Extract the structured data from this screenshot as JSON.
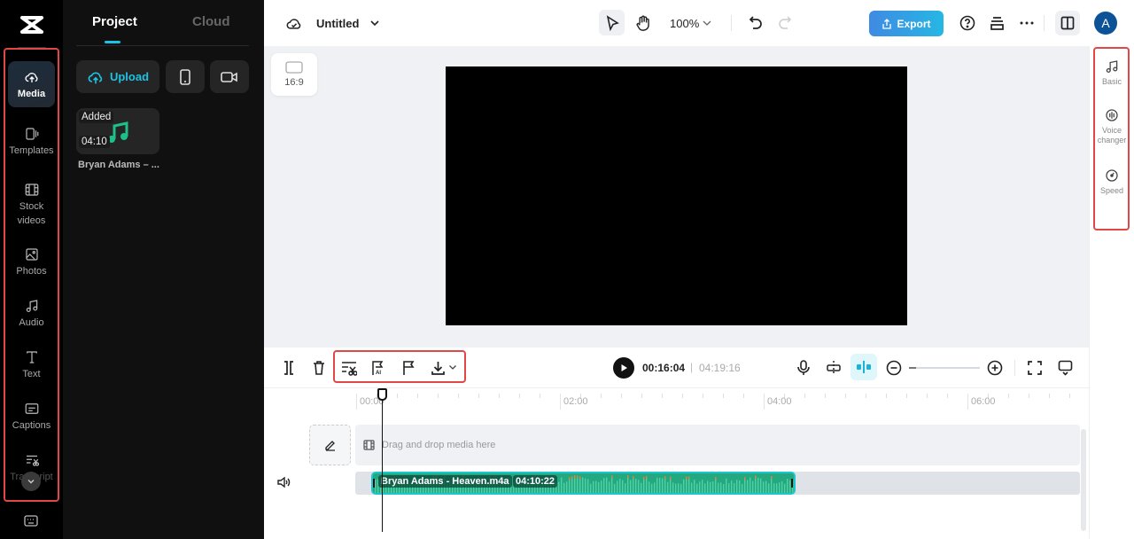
{
  "app": {
    "logo": "capcut-logo-icon"
  },
  "rail": {
    "items": [
      {
        "label": "Media",
        "icon": "cloud-upload-icon",
        "active": true
      },
      {
        "label": "Templates",
        "icon": "templates-icon"
      },
      {
        "label": "Stock videos",
        "icon": "film-icon"
      },
      {
        "label": "Photos",
        "icon": "photo-icon"
      },
      {
        "label": "Audio",
        "icon": "music-note-icon"
      },
      {
        "label": "Text",
        "icon": "text-icon"
      },
      {
        "label": "Captions",
        "icon": "captions-icon"
      },
      {
        "label": "Transcript",
        "icon": "transcript-icon"
      }
    ],
    "more": "chevron-down-icon",
    "keyboard": "keyboard-icon"
  },
  "panel": {
    "tabs": [
      {
        "label": "Project",
        "active": true
      },
      {
        "label": "Cloud"
      }
    ],
    "upload_label": "Upload",
    "media": [
      {
        "badge": "Added",
        "duration": "04:10",
        "title": "Bryan Adams – ..."
      }
    ]
  },
  "topbar": {
    "project_name": "Untitled",
    "zoom": "100%",
    "export_label": "Export",
    "avatar_initial": "A"
  },
  "canvas": {
    "ratio": "16:9"
  },
  "right_panel": {
    "items": [
      {
        "label": "Basic"
      },
      {
        "label": "Voice changer"
      },
      {
        "label": "Speed"
      }
    ]
  },
  "timeline": {
    "current_time": "00:16:04",
    "separator": "|",
    "total_time": "04:19:16",
    "ruler": [
      "00:00",
      "02:00",
      "04:00",
      "06:00"
    ],
    "drop_hint": "Drag and drop media here",
    "clip": {
      "name": "Bryan Adams - Heaven.m4a",
      "duration": "04:10:22"
    },
    "zoom_level": 0.1
  }
}
